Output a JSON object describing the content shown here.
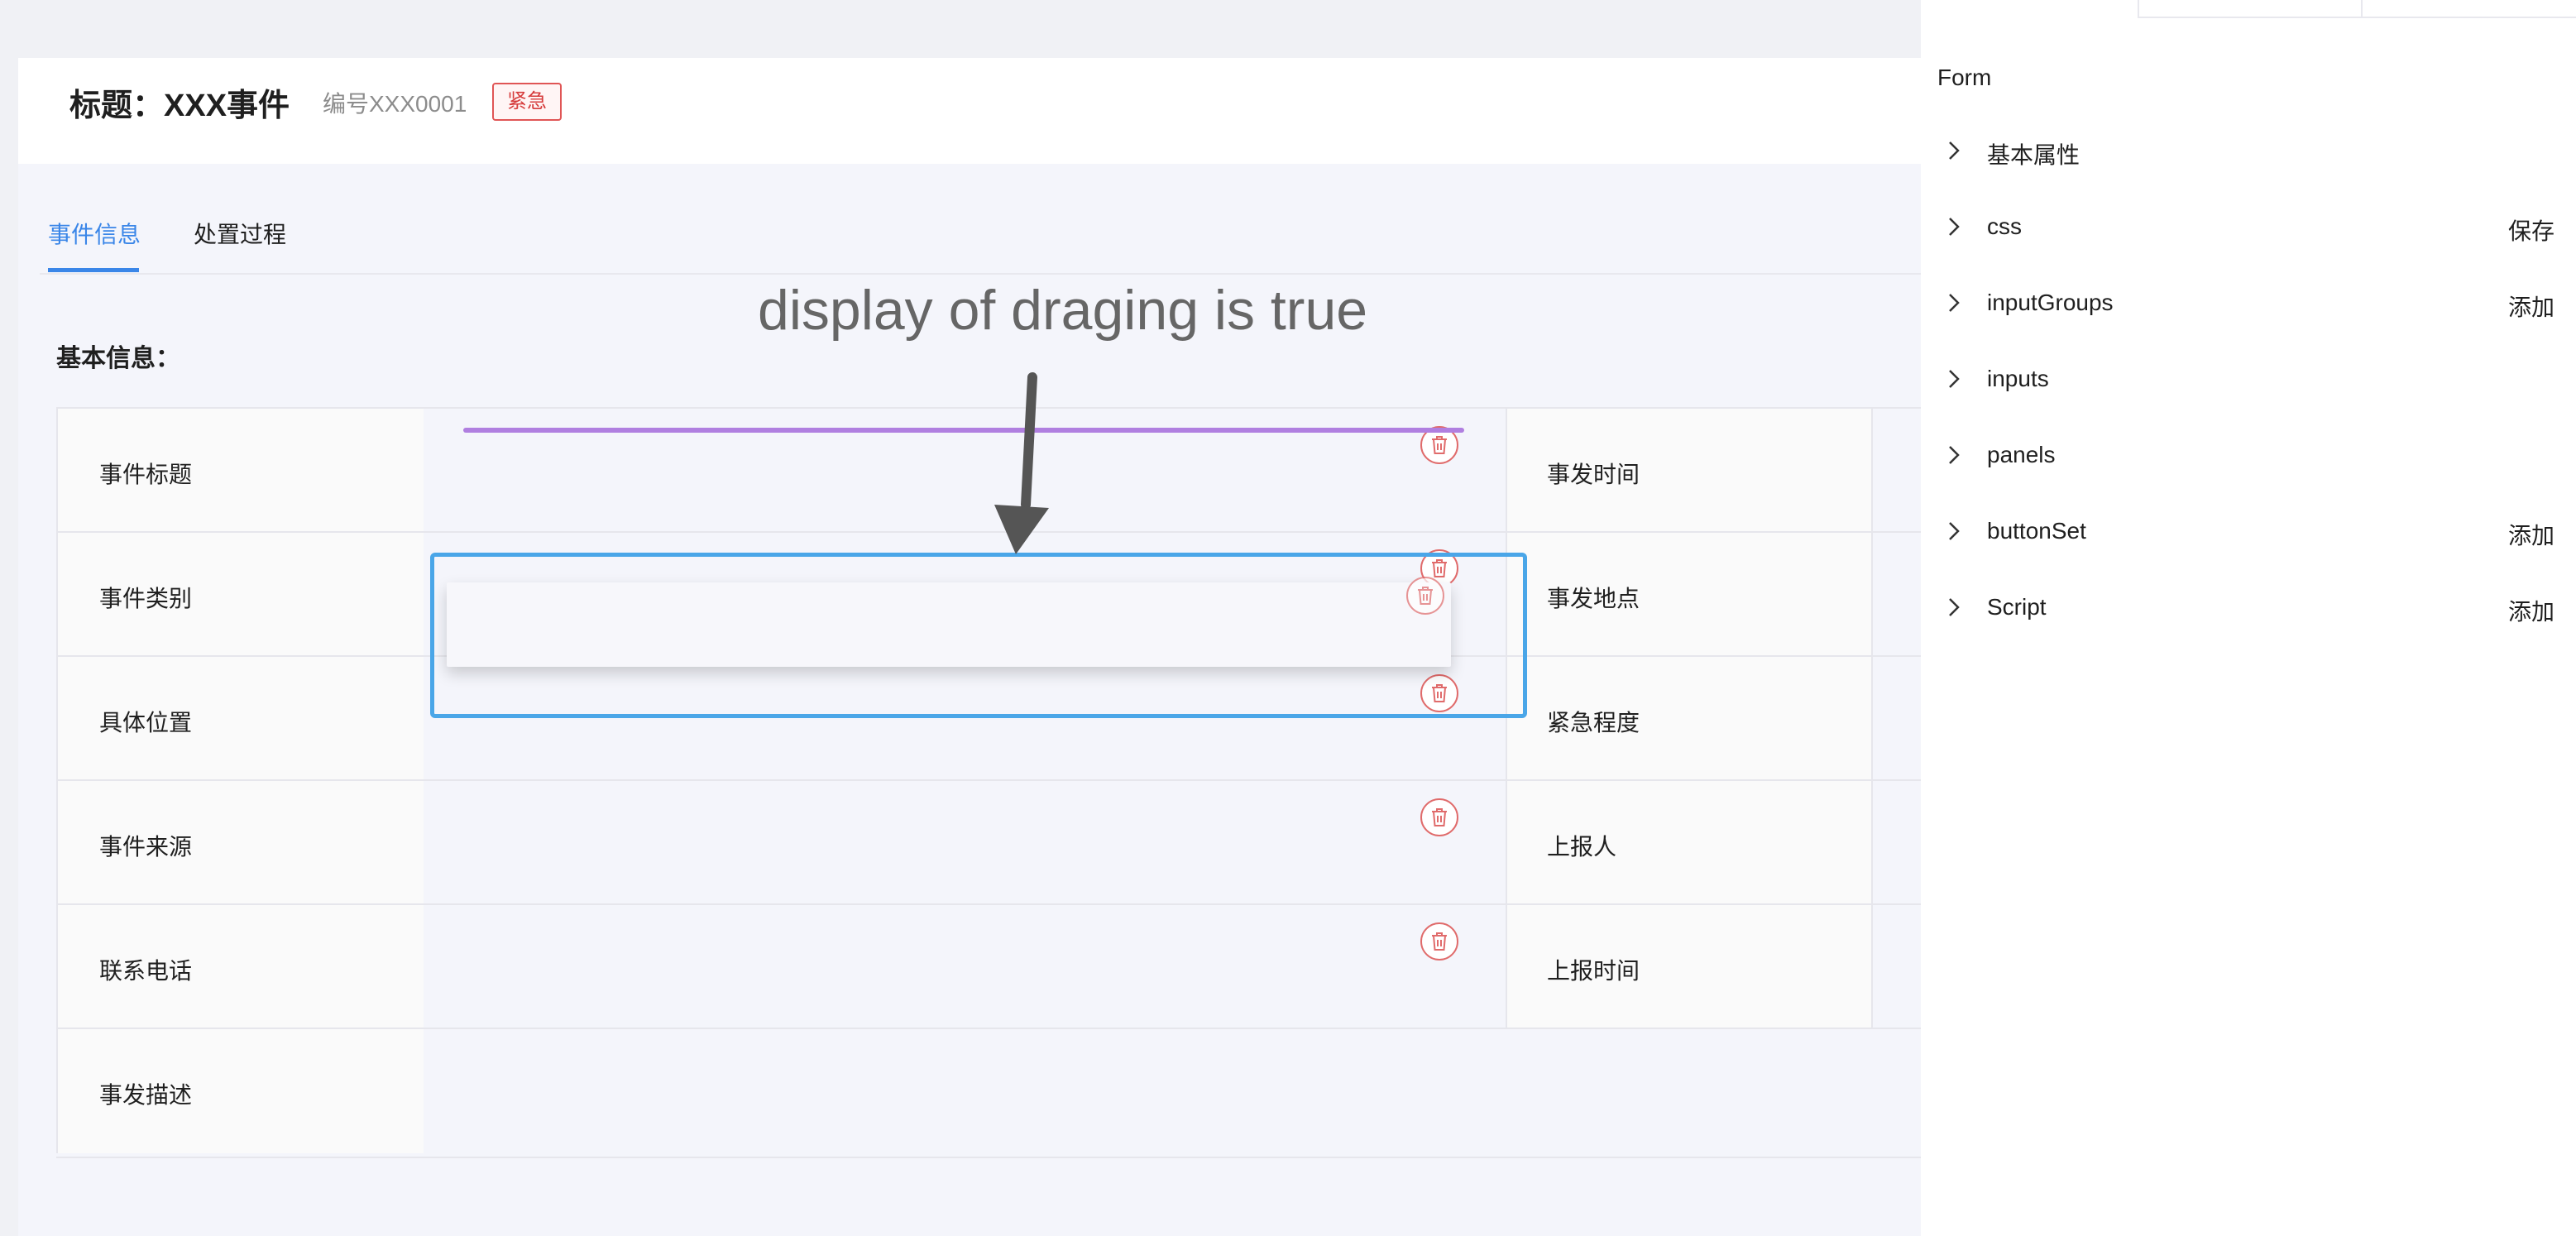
{
  "header": {
    "title": "标题：XXX事件",
    "code": "编号XXX0001",
    "badge": "紧急"
  },
  "tabs": [
    {
      "label": "事件信息",
      "active": true
    },
    {
      "label": "处置过程",
      "active": false
    }
  ],
  "section": {
    "title": "基本信息："
  },
  "form": {
    "rows": [
      {
        "left_label": "事件标题",
        "right_label": "事发时间"
      },
      {
        "left_label": "事件类别",
        "right_label": "事发地点"
      },
      {
        "left_label": "具体位置",
        "right_label": "紧急程度"
      },
      {
        "left_label": "事件来源",
        "right_label": "上报人"
      },
      {
        "left_label": "联系电话",
        "right_label": "上报时间"
      },
      {
        "left_label": "事发描述",
        "right_label": ""
      }
    ]
  },
  "annotation": {
    "text": "display of draging is true"
  },
  "side_panel": {
    "title": "Form",
    "items": [
      {
        "label": "基本属性",
        "action": ""
      },
      {
        "label": "css",
        "action": "保存"
      },
      {
        "label": "inputGroups",
        "action": "添加"
      },
      {
        "label": "inputs",
        "action": ""
      },
      {
        "label": "panels",
        "action": ""
      },
      {
        "label": "buttonSet",
        "action": "添加"
      },
      {
        "label": "Script",
        "action": "添加"
      }
    ]
  },
  "colors": {
    "accent": "#3a86e8",
    "danger": "#e06b6b",
    "drop_indicator": "#b07fe0",
    "drag_outline": "#4aa6e8"
  },
  "icons": {
    "delete": "trash-icon",
    "expand": "chevron-right-icon",
    "arrow": "arrow-down-icon"
  }
}
